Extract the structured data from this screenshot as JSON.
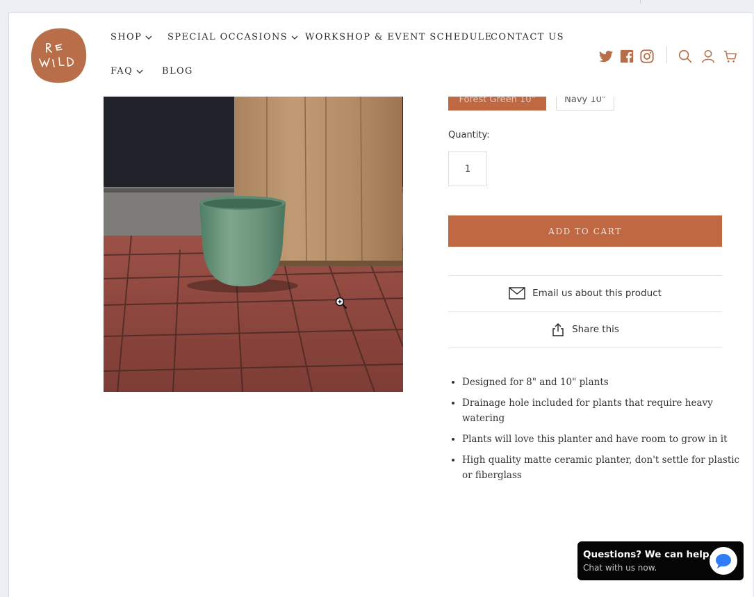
{
  "brand": {
    "logo_letters": [
      "R",
      "E",
      "W",
      "I",
      "L",
      "D"
    ],
    "color": "#b86e48"
  },
  "nav": {
    "row1": [
      {
        "label": "SHOP",
        "dropdown": true
      },
      {
        "label": "SPECIAL OCCASIONS",
        "dropdown": true
      },
      {
        "label": "WORKSHOP & EVENT SCHEDULE",
        "dropdown": false
      },
      {
        "label": "CONTACT US",
        "dropdown": false
      }
    ],
    "row2": [
      {
        "label": "FAQ",
        "dropdown": true
      },
      {
        "label": "BLOG",
        "dropdown": false
      }
    ]
  },
  "header_icons": [
    "twitter-icon",
    "facebook-icon",
    "instagram-icon",
    "search-icon",
    "account-icon",
    "cart-icon"
  ],
  "product": {
    "variants": [
      {
        "label": "Forest Green 10\"",
        "selected": true
      },
      {
        "label": "Navy 10\"",
        "selected": false
      }
    ],
    "quantity_label": "Quantity:",
    "quantity_value": "1",
    "add_to_cart_label": "ADD TO CART",
    "email_label": "Email us about this product",
    "share_label": "Share this",
    "features": [
      "Designed for 8\" and 10\" plants",
      "Drainage hole included for plants that require heavy watering",
      "Plants will love this planter and have room to grow in it",
      "High quality matte ceramic planter, don't settle for plastic or fiberglass"
    ]
  },
  "chat": {
    "title": "Questions? We can help.",
    "subtitle": "Chat with us now."
  },
  "colors": {
    "accent": "#c06842",
    "chat_bg": "#050505",
    "chat_bubble": "#2f7df6"
  }
}
